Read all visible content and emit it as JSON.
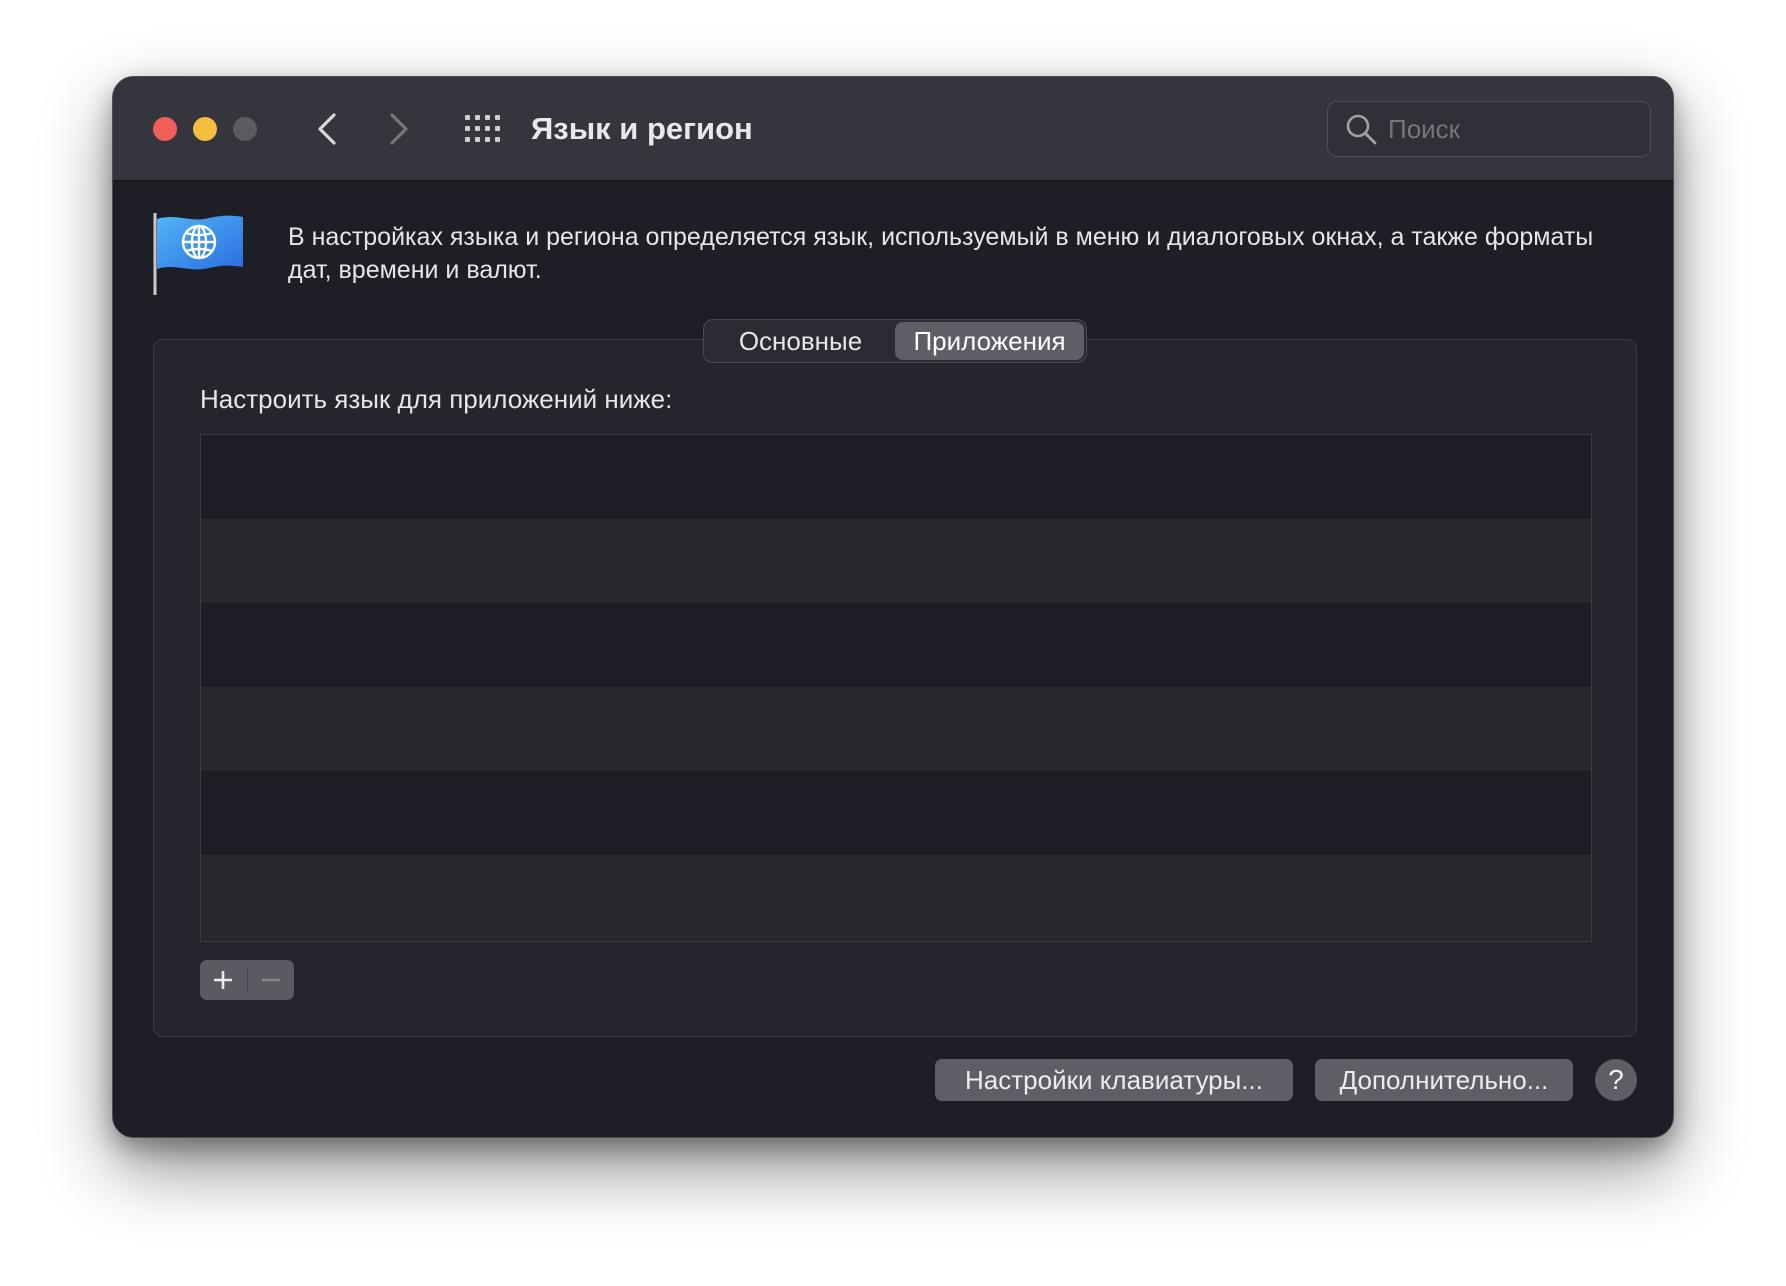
{
  "window": {
    "title": "Язык и регион"
  },
  "toolbar": {
    "back_icon": "chevron-left-icon",
    "forward_icon": "chevron-right-icon",
    "show_all_icon": "grid-icon"
  },
  "search": {
    "placeholder": "Поиск",
    "value": ""
  },
  "header": {
    "icon": "globe-flag-icon",
    "description": "В настройках языка и региона определяется язык, используемый в меню и диалоговых окнах, а также форматы дат, времени и валют."
  },
  "tabs": [
    {
      "label": "Основные",
      "active": false
    },
    {
      "label": "Приложения",
      "active": true
    }
  ],
  "apps_panel": {
    "label": "Настроить язык для приложений ниже:",
    "items": [],
    "add_icon": "plus-icon",
    "remove_icon": "minus-icon"
  },
  "footer": {
    "keyboard_button": "Настройки клавиатуры...",
    "advanced_button": "Дополнительно...",
    "help_label": "?"
  },
  "colors": {
    "close": "#ee5f57",
    "minimize": "#f6be3f",
    "zoom_disabled": "#5b5b61",
    "window_bg": "#1e1e26",
    "titlebar_bg": "#35353d",
    "button_bg": "#5e5e66"
  }
}
